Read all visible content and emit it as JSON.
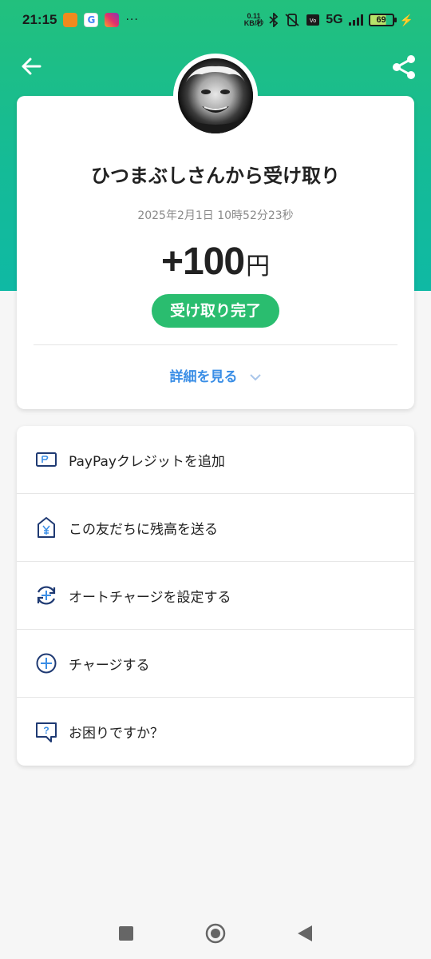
{
  "status_bar": {
    "time": "21:15",
    "google_badge": "G",
    "more_dots": "···",
    "net_speed_value": "0.11",
    "net_speed_unit": "KB/秒",
    "network": "5G",
    "battery": "69"
  },
  "transaction": {
    "title": "ひつまぶしさんから受け取り",
    "datetime": "2025年2月1日 10時52分23秒",
    "amount": "+100",
    "currency": "円",
    "status": "受け取り完了",
    "details_link": "詳細を見る"
  },
  "actions": [
    {
      "label": "PayPayクレジットを追加",
      "icon": "card-icon"
    },
    {
      "label": "この友だちに残高を送る",
      "icon": "yen-send-icon"
    },
    {
      "label": "オートチャージを設定する",
      "icon": "auto-charge-icon"
    },
    {
      "label": "チャージする",
      "icon": "plus-circle-icon"
    },
    {
      "label": "お困りですか？",
      "icon": "help-chat-icon"
    }
  ],
  "colors": {
    "header_green": "#22c07d",
    "accent_blue": "#3a8ee6",
    "status_green": "#2abd6f",
    "icon_navy": "#1f3a73"
  }
}
